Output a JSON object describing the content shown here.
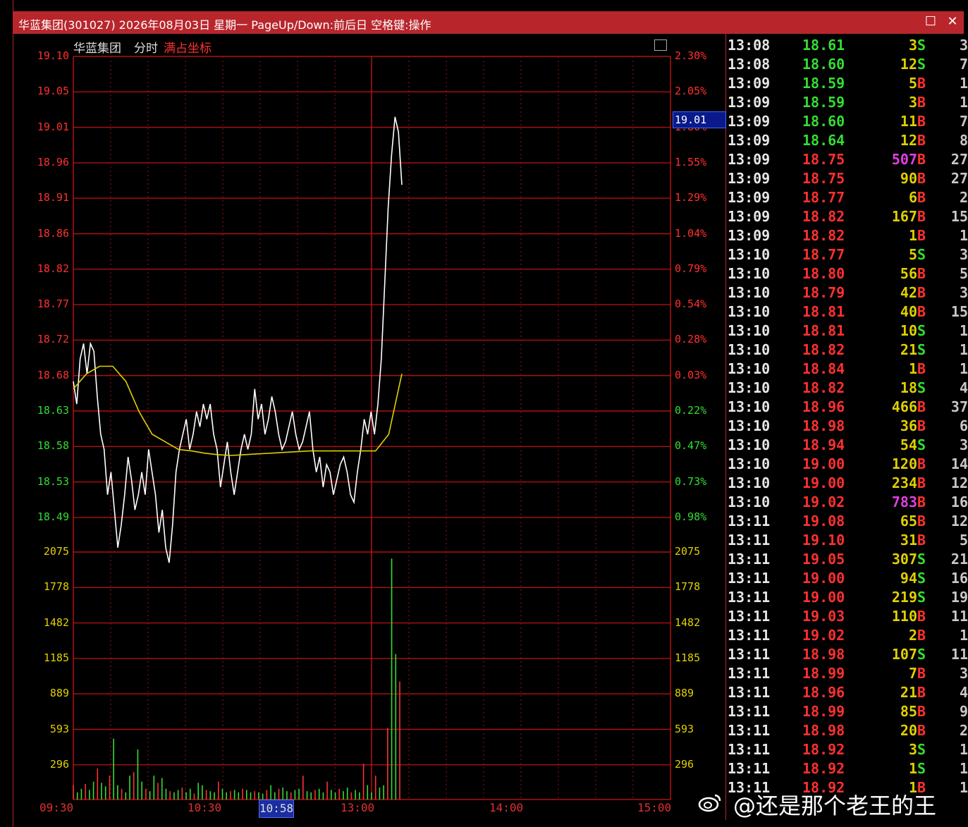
{
  "window": {
    "title": "华蓝集团(301027) 2026年08月03日 星期一 PageUp/Down:前后日 空格键:操作",
    "restore_icon": "restore-icon",
    "close_icon": "close-icon"
  },
  "header": {
    "stock_name": "华蓝集团",
    "mode": "分时",
    "scale_mode": "满占坐标"
  },
  "colors": {
    "up": "#ff3030",
    "down": "#33dd33",
    "avg_line": "#e0d000",
    "price_line": "#ffffff",
    "grid": "#b01010",
    "volume_axis": "#e0d000",
    "big_volume": "#e040e0"
  },
  "price_axis": {
    "left": [
      "19.10",
      "19.05",
      "19.01",
      "18.96",
      "18.91",
      "18.86",
      "18.82",
      "18.77",
      "18.72",
      "18.68",
      "18.63",
      "18.58",
      "18.53",
      "18.49"
    ],
    "right": [
      "2.30%",
      "2.05%",
      "1.80%",
      "1.55%",
      "1.29%",
      "1.04%",
      "0.79%",
      "0.54%",
      "0.28%",
      "0.03%",
      "0.22%",
      "0.47%",
      "0.73%",
      "0.98%"
    ],
    "current_price": "19.01"
  },
  "volume_axis": {
    "left": [
      "2075",
      "1778",
      "1482",
      "1185",
      "889",
      "593",
      "296"
    ],
    "right": [
      "2075",
      "1778",
      "1482",
      "1185",
      "889",
      "593",
      "296"
    ]
  },
  "time_axis": {
    "labels": [
      "09:30",
      "10:30",
      "13:00",
      "14:00",
      "15:00"
    ],
    "cursor": "10:58"
  },
  "chart_data": {
    "type": "line",
    "title": "",
    "xlabel": "",
    "ylabel": "",
    "ylim": [
      18.49,
      19.1
    ],
    "x_range": [
      "09:30",
      "15:00"
    ],
    "series": [
      {
        "values": [
          18.67,
          18.64,
          18.7,
          18.72,
          18.68,
          18.72,
          18.71,
          18.65,
          18.6,
          18.58,
          18.52,
          18.55,
          18.5,
          18.45,
          18.48,
          18.52,
          18.57,
          18.54,
          18.5,
          18.52,
          18.55,
          18.52,
          18.58,
          18.55,
          18.52,
          18.47,
          18.5,
          18.45,
          18.43,
          18.48,
          18.55,
          18.58,
          18.6,
          18.62,
          18.58,
          18.6,
          18.63,
          18.61,
          18.64,
          18.62,
          18.64,
          18.6,
          18.58,
          18.53,
          18.56,
          18.59,
          18.55,
          18.52,
          18.55,
          18.58,
          18.6,
          18.58,
          18.6,
          18.66,
          18.62,
          18.64,
          18.6,
          18.62,
          18.65,
          18.63,
          18.6,
          18.58,
          18.59,
          18.61,
          18.63,
          18.6,
          18.58,
          18.59,
          18.61,
          18.63,
          18.58,
          18.55,
          18.57,
          18.53,
          18.56,
          18.55,
          18.52,
          18.54,
          18.56,
          18.57,
          18.55,
          18.52,
          18.51,
          18.55,
          18.58,
          18.62,
          18.6,
          18.63,
          18.6,
          18.64,
          18.7,
          18.8,
          18.9,
          18.97,
          19.02,
          19.0,
          18.93
        ]
      },
      {
        "values": [
          18.66,
          18.68,
          18.69,
          18.69,
          18.67,
          18.63,
          18.6,
          18.59,
          18.58,
          18.578,
          18.575,
          18.573,
          18.572,
          18.573,
          18.574,
          18.575,
          18.576,
          18.577,
          18.578,
          18.578,
          18.578,
          18.578,
          18.578,
          18.578,
          18.6,
          18.68
        ]
      }
    ],
    "volume": {
      "ylim": [
        0,
        2075
      ],
      "values": [
        120,
        60,
        90,
        130,
        80,
        150,
        260,
        140,
        110,
        200,
        510,
        120,
        90,
        60,
        200,
        230,
        420,
        150,
        90,
        70,
        200,
        140,
        180,
        90,
        70,
        60,
        80,
        100,
        60,
        90,
        50,
        140,
        120,
        80,
        70,
        60,
        150,
        90,
        60,
        70,
        80,
        60,
        90,
        80,
        60,
        70,
        60,
        50,
        80,
        120,
        60,
        90,
        100,
        70,
        60,
        80,
        90,
        200,
        70,
        60,
        80,
        90,
        60,
        150,
        80,
        60,
        90,
        70,
        100,
        60,
        80,
        60,
        300,
        120,
        60,
        200,
        100,
        120,
        600,
        2020,
        1220,
        990
      ]
    }
  },
  "ticks": {
    "rows": [
      {
        "time": "13:08",
        "price": "18.61",
        "vol": "3",
        "side": "S",
        "n": "3"
      },
      {
        "time": "13:08",
        "price": "18.60",
        "vol": "12",
        "side": "S",
        "n": "7"
      },
      {
        "time": "13:09",
        "price": "18.59",
        "vol": "5",
        "side": "B",
        "n": "1"
      },
      {
        "time": "13:09",
        "price": "18.59",
        "vol": "3",
        "side": "B",
        "n": "1"
      },
      {
        "time": "13:09",
        "price": "18.60",
        "vol": "11",
        "side": "B",
        "n": "7"
      },
      {
        "time": "13:09",
        "price": "18.64",
        "vol": "12",
        "side": "B",
        "n": "8"
      },
      {
        "time": "13:09",
        "price": "18.75",
        "vol": "507",
        "side": "B",
        "n": "27"
      },
      {
        "time": "13:09",
        "price": "18.75",
        "vol": "90",
        "side": "B",
        "n": "27"
      },
      {
        "time": "13:09",
        "price": "18.77",
        "vol": "6",
        "side": "B",
        "n": "2"
      },
      {
        "time": "13:09",
        "price": "18.82",
        "vol": "167",
        "side": "B",
        "n": "15"
      },
      {
        "time": "13:09",
        "price": "18.82",
        "vol": "1",
        "side": "B",
        "n": "1"
      },
      {
        "time": "13:10",
        "price": "18.77",
        "vol": "5",
        "side": "S",
        "n": "3"
      },
      {
        "time": "13:10",
        "price": "18.80",
        "vol": "56",
        "side": "B",
        "n": "5"
      },
      {
        "time": "13:10",
        "price": "18.79",
        "vol": "42",
        "side": "B",
        "n": "3"
      },
      {
        "time": "13:10",
        "price": "18.81",
        "vol": "40",
        "side": "B",
        "n": "15"
      },
      {
        "time": "13:10",
        "price": "18.81",
        "vol": "10",
        "side": "S",
        "n": "1"
      },
      {
        "time": "13:10",
        "price": "18.82",
        "vol": "21",
        "side": "S",
        "n": "1"
      },
      {
        "time": "13:10",
        "price": "18.84",
        "vol": "1",
        "side": "B",
        "n": "1"
      },
      {
        "time": "13:10",
        "price": "18.82",
        "vol": "18",
        "side": "S",
        "n": "4"
      },
      {
        "time": "13:10",
        "price": "18.96",
        "vol": "466",
        "side": "B",
        "n": "37"
      },
      {
        "time": "13:10",
        "price": "18.98",
        "vol": "36",
        "side": "B",
        "n": "6"
      },
      {
        "time": "13:10",
        "price": "18.94",
        "vol": "54",
        "side": "S",
        "n": "3"
      },
      {
        "time": "13:10",
        "price": "19.00",
        "vol": "120",
        "side": "B",
        "n": "14"
      },
      {
        "time": "13:10",
        "price": "19.00",
        "vol": "234",
        "side": "B",
        "n": "12"
      },
      {
        "time": "13:10",
        "price": "19.02",
        "vol": "783",
        "side": "B",
        "n": "16"
      },
      {
        "time": "13:11",
        "price": "19.08",
        "vol": "65",
        "side": "B",
        "n": "12"
      },
      {
        "time": "13:11",
        "price": "19.10",
        "vol": "31",
        "side": "B",
        "n": "5"
      },
      {
        "time": "13:11",
        "price": "19.05",
        "vol": "307",
        "side": "S",
        "n": "21"
      },
      {
        "time": "13:11",
        "price": "19.00",
        "vol": "94",
        "side": "S",
        "n": "16"
      },
      {
        "time": "13:11",
        "price": "19.00",
        "vol": "219",
        "side": "S",
        "n": "19"
      },
      {
        "time": "13:11",
        "price": "19.03",
        "vol": "110",
        "side": "B",
        "n": "11"
      },
      {
        "time": "13:11",
        "price": "19.02",
        "vol": "2",
        "side": "B",
        "n": "1"
      },
      {
        "time": "13:11",
        "price": "18.98",
        "vol": "107",
        "side": "S",
        "n": "11"
      },
      {
        "time": "13:11",
        "price": "18.99",
        "vol": "7",
        "side": "B",
        "n": "3"
      },
      {
        "time": "13:11",
        "price": "18.96",
        "vol": "21",
        "side": "B",
        "n": "4"
      },
      {
        "time": "13:11",
        "price": "18.99",
        "vol": "85",
        "side": "B",
        "n": "9"
      },
      {
        "time": "13:11",
        "price": "18.98",
        "vol": "20",
        "side": "B",
        "n": "2"
      },
      {
        "time": "13:11",
        "price": "18.92",
        "vol": "3",
        "side": "S",
        "n": "1"
      },
      {
        "time": "13:11",
        "price": "18.92",
        "vol": "1",
        "side": "S",
        "n": "1"
      },
      {
        "time": "13:11",
        "price": "18.92",
        "vol": "1",
        "side": "B",
        "n": "1"
      }
    ]
  },
  "watermark": {
    "text": "@还是那个老王的王",
    "icon": "weibo-icon"
  }
}
